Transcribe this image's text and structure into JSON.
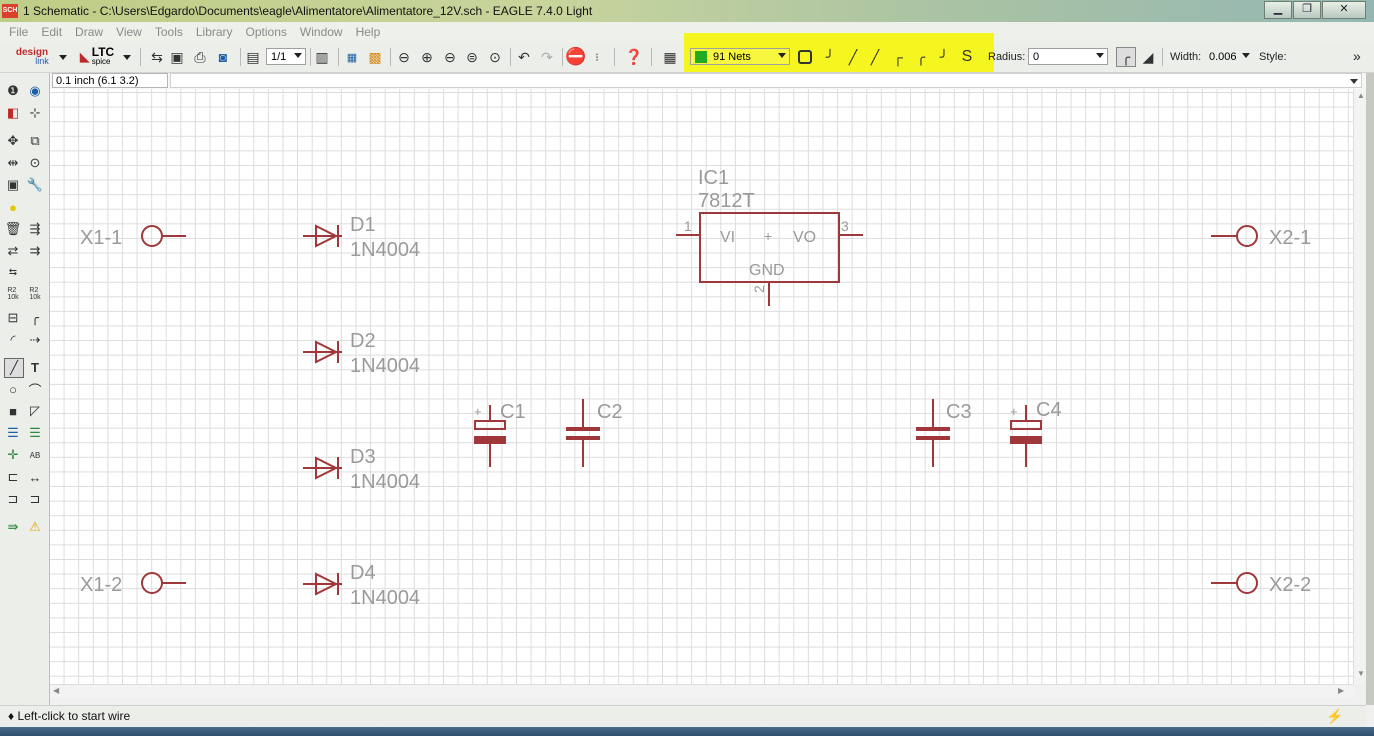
{
  "window": {
    "app_icon": "SCH",
    "title": "1 Schematic - C:\\Users\\Edgardo\\Documents\\eagle\\Alimentatore\\Alimentatore_12V.sch - EAGLE 7.4.0 Light",
    "minimize": "▁",
    "maximize": "❐",
    "close": "✕"
  },
  "menu": [
    "File",
    "Edit",
    "Draw",
    "View",
    "Tools",
    "Library",
    "Options",
    "Window",
    "Help"
  ],
  "toolbar": {
    "designlink_line1": "design",
    "designlink_line2": "link",
    "ltc_line1": "LTC",
    "ltc_line2": "spice",
    "sheet_select": "1/1",
    "net_class": "91 Nets",
    "net_class_color": "#22aa22",
    "radius_label": "Radius:",
    "radius_value": "0",
    "width_label": "Width:",
    "width_value": "0.006",
    "style_label": "Style:",
    "more": "»"
  },
  "coord": {
    "value": "0.1 inch (6.1 3.2)"
  },
  "schematic": {
    "labels": {
      "x1_1": "X1-1",
      "x1_2": "X1-2",
      "x2_1": "X2-1",
      "x2_2": "X2-2",
      "d1_name": "D1",
      "d1_value": "1N4004",
      "d2_name": "D2",
      "d2_value": "1N4004",
      "d3_name": "D3",
      "d3_value": "1N4004",
      "d4_name": "D4",
      "d4_value": "1N4004",
      "ic_name": "IC1",
      "ic_value": "7812T",
      "ic_vi": "VI",
      "ic_vo": "VO",
      "ic_gnd": "GND",
      "ic_pin1": "1",
      "ic_pin2": "2",
      "ic_pin3": "3",
      "c1": "C1",
      "c2": "C2",
      "c3": "C3",
      "c4": "C4",
      "plus": "+"
    },
    "colors": {
      "symbol": "#a0373a",
      "text": "#9a9a9a"
    }
  },
  "status": {
    "text": "♦ Left-click to start wire"
  }
}
